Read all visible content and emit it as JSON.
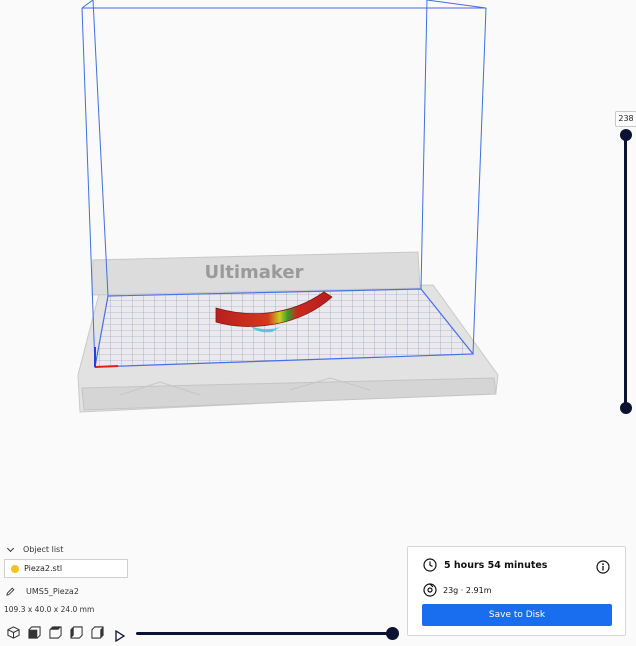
{
  "viewport": {
    "brand_text": "Ultimaker",
    "accent_color": "#196ef0",
    "build_volume_color": "#3f6fe0"
  },
  "layer_slider": {
    "current_layer": "238",
    "min_level": 0,
    "max_level": 1
  },
  "object_list": {
    "header": "Object list",
    "items": [
      {
        "name": "Pieza2.stl",
        "color": "#f4c11d"
      }
    ]
  },
  "job": {
    "name": "UMS5_Pieza2",
    "dimensions": "109.3 x 40.0 x 24.0 mm"
  },
  "view_buttons": [
    "3d-view-icon",
    "front-view-icon",
    "top-view-icon",
    "left-view-icon",
    "right-view-icon"
  ],
  "simulation": {
    "progress": 1.0
  },
  "print_info": {
    "time": "5 hours 54 minutes",
    "material": "23g · 2.91m",
    "save_label": "Save to Disk"
  }
}
